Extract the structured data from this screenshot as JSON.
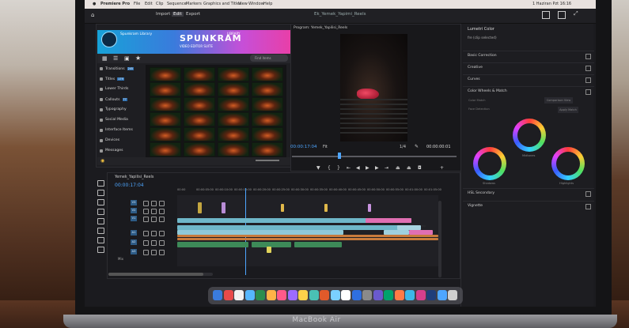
{
  "menubar": {
    "app": "Premiere Pro",
    "items": [
      "File",
      "Edit",
      "Clip",
      "Sequence",
      "Markers",
      "Graphics and Titles",
      "View",
      "Window",
      "Help"
    ],
    "clock": "1 Haziran Pzt 16:16"
  },
  "app_header": {
    "tabs": [
      "Import",
      "Edit",
      "Export"
    ],
    "active_tab": "Edit",
    "document_title": "Ek_Yemek_Yapimi_Reels"
  },
  "library_panel": {
    "header": "Spunkram Library",
    "banner_title": "SPUNKRAM",
    "banner_sub": "VIDEO EDITOR SUITE",
    "banner_small": "LIBRARY",
    "search_placeholder": "Find items",
    "categories": [
      {
        "label": "Transitions",
        "count": "245"
      },
      {
        "label": "Titles",
        "count": "179"
      },
      {
        "label": "Lower Thirds",
        "count": ""
      },
      {
        "label": "Callouts",
        "count": "77"
      },
      {
        "label": "Typography",
        "count": ""
      },
      {
        "label": "Social Media",
        "count": ""
      },
      {
        "label": "Interface Items",
        "count": ""
      },
      {
        "label": "Devices",
        "count": ""
      },
      {
        "label": "Messages",
        "count": ""
      }
    ]
  },
  "program_monitor": {
    "title": "Program: Yemek_Yapilisi_Reels",
    "timecode_left": "00:00:17:04",
    "fit_label": "Fit",
    "resolution": "1/4",
    "timecode_right": "00:00:00:01"
  },
  "lumetri": {
    "title": "Lumetri Color",
    "clip_label": "fre (clip selected)",
    "sections": [
      "Basic Correction",
      "Creative",
      "Curves",
      "Color Wheels & Match"
    ],
    "sub_items": [
      "Color Match",
      "Face Detection"
    ],
    "buttons": [
      "Comparison View",
      "Apply Match"
    ],
    "wheels": [
      "Midtones",
      "Shadows",
      "Highlights"
    ],
    "sections_lower": [
      "HSL Secondary",
      "Vignette"
    ]
  },
  "timeline": {
    "sequence_name": "Yemek_Yapilisi_Reels",
    "timecode": "00:00:17:04",
    "ruler": [
      "00:00",
      "00:00:05:00",
      "00:00:10:00",
      "00:00:15:00",
      "00:00:20:00",
      "00:00:25:00",
      "00:00:30:00",
      "00:00:35:00",
      "00:00:40:00",
      "00:00:45:00",
      "00:00:50:00",
      "00:00:55:00",
      "00:01:00:00",
      "00:01:05:00"
    ],
    "tracks": [
      "V3",
      "V2",
      "V1",
      "A1",
      "A2",
      "A3"
    ],
    "clip_labels": [
      "MB004.mp",
      "MB019",
      "MB020.mp",
      "Subtitle"
    ],
    "mix_label": "Mix"
  },
  "laptop": {
    "brand": "MacBook Air"
  }
}
